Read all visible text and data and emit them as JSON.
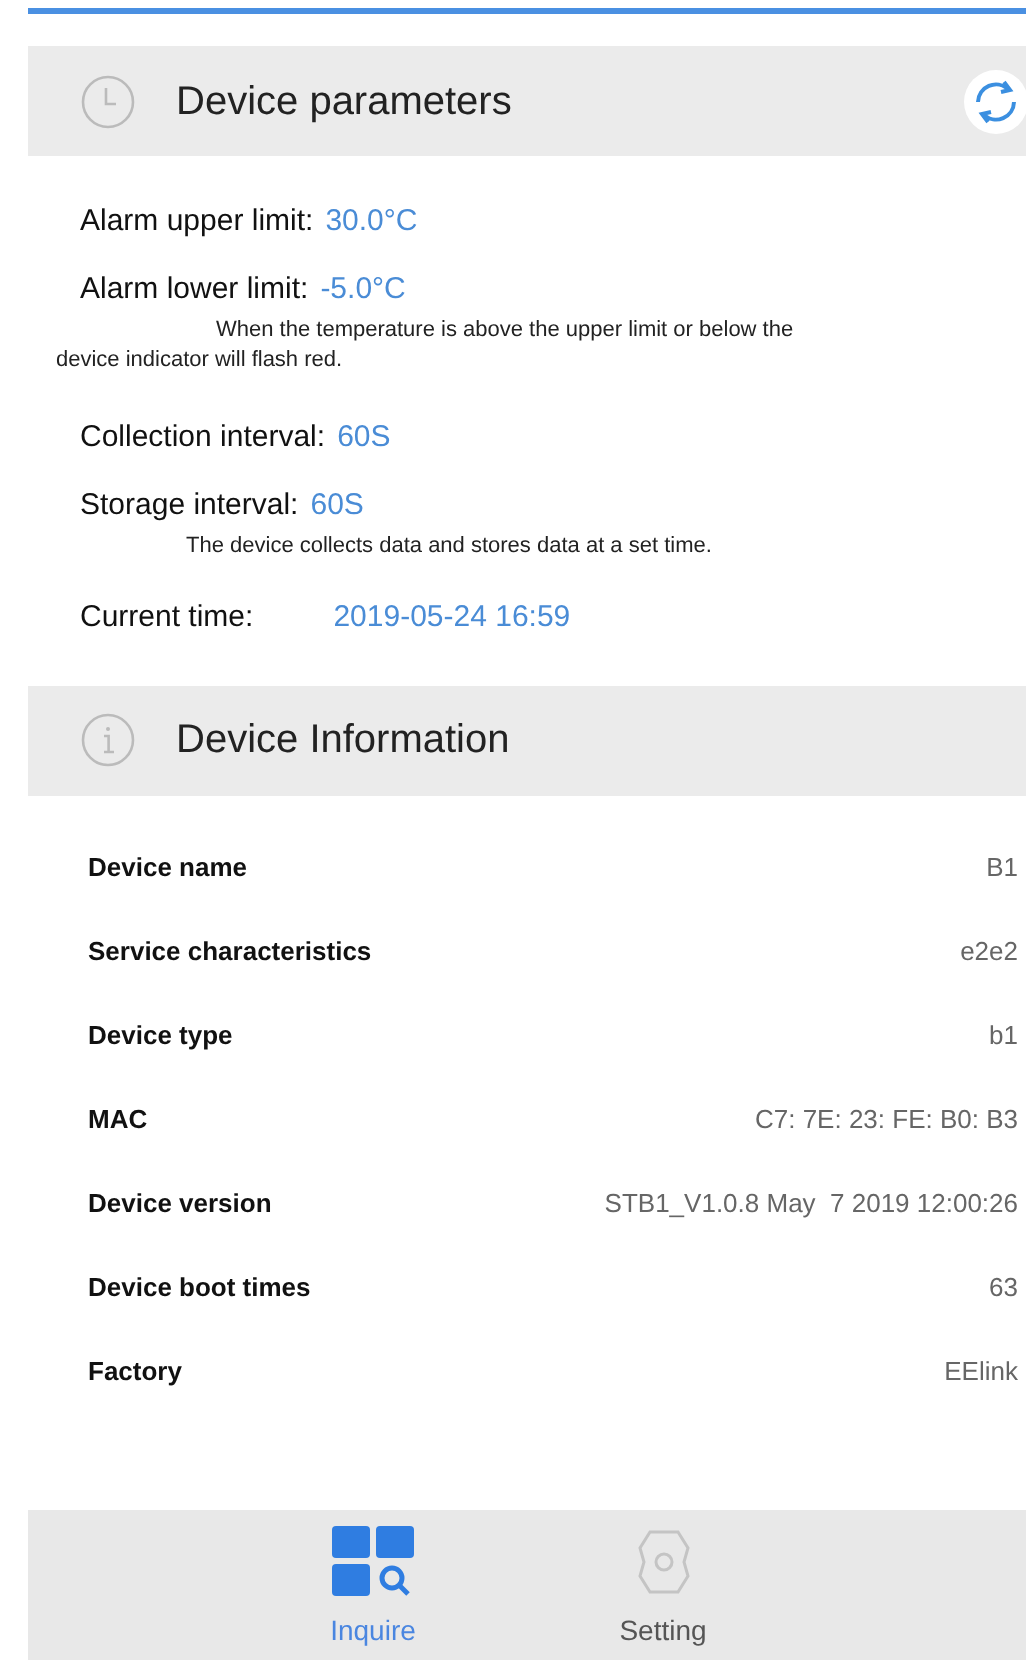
{
  "parameters": {
    "title": "Device parameters",
    "rows": [
      {
        "label": "Alarm upper limit:",
        "value": "30.0°C",
        "kind": "setting"
      },
      {
        "label": "Alarm lower limit:",
        "value": "-5.0°C",
        "kind": "setting"
      },
      {
        "kind": "note",
        "lines": [
          "When the temperature is above the upper limit or below the",
          "device indicator will flash red."
        ]
      },
      {
        "label": "Collection interval:",
        "value": "60S",
        "kind": "setting"
      },
      {
        "label": "Storage interval:",
        "value": "60S",
        "kind": "setting"
      },
      {
        "kind": "note",
        "lines": [
          "The device collects data and stores data at a set time."
        ]
      },
      {
        "label": "Current time:",
        "value": "2019-05-24 16:59",
        "kind": "time"
      }
    ]
  },
  "information": {
    "title": "Device Information",
    "rows": [
      {
        "label": "Device name",
        "value": "B1"
      },
      {
        "label": "Service characteristics",
        "value": "e2e2"
      },
      {
        "label": "Device type",
        "value": "b1"
      },
      {
        "label": "MAC",
        "value": "C7: 7E: 23: FE: B0: B3"
      },
      {
        "label": "Device version",
        "value": "STB1_V1.0.8 May  7 2019 12:00:26"
      },
      {
        "label": "Device boot times",
        "value": "63"
      },
      {
        "label": "Factory",
        "value": "EElink"
      }
    ]
  },
  "tabs": [
    {
      "label": "Inquire",
      "selected": true,
      "kind": "inquire"
    },
    {
      "label": "Setting",
      "selected": false,
      "kind": "setting"
    }
  ]
}
